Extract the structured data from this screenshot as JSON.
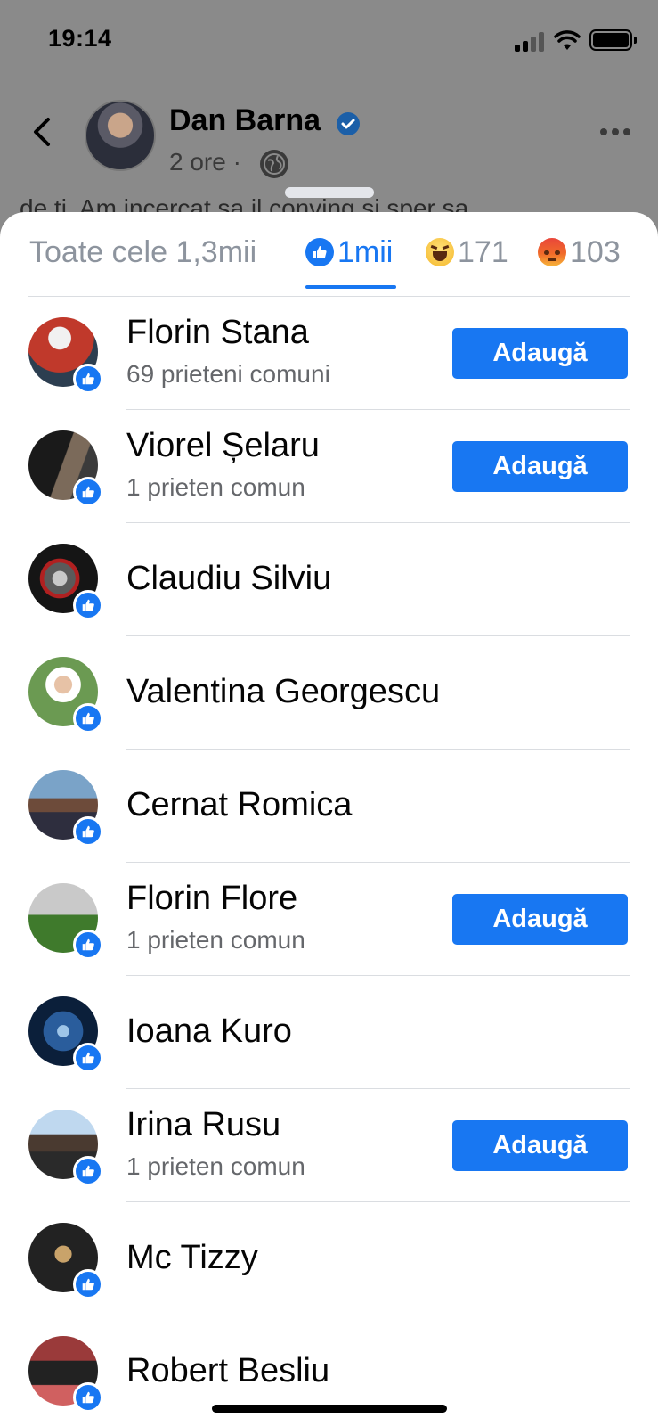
{
  "status_bar": {
    "time": "19:14"
  },
  "post_header": {
    "author": "Dan Barna",
    "time": "2 ore",
    "separator": "·",
    "text_peek": "de ti. Am incercat sa il conving si sper sa"
  },
  "tabs": [
    {
      "label": "Toate cele 1,3mii",
      "active": false
    },
    {
      "label": "1mii",
      "icon": "like-icon",
      "active": true
    },
    {
      "label": "171",
      "icon": "haha-emoji-icon",
      "active": false
    },
    {
      "label": "103",
      "icon": "angry-emoji-icon",
      "active": false
    }
  ],
  "people": [
    {
      "name": "Florin Stana",
      "mutual": "69 prieteni comuni",
      "button": "Adaugă"
    },
    {
      "name": "Viorel Șelaru",
      "mutual": "1 prieten comun",
      "button": "Adaugă"
    },
    {
      "name": "Claudiu Silviu"
    },
    {
      "name": "Valentina Georgescu"
    },
    {
      "name": "Cernat Romica"
    },
    {
      "name": "Florin Flore",
      "mutual": "1 prieten comun",
      "button": "Adaugă"
    },
    {
      "name": "Ioana Kuro"
    },
    {
      "name": "Irina Rusu",
      "mutual": "1 prieten comun",
      "button": "Adaugă"
    },
    {
      "name": "Mc Tizzy"
    },
    {
      "name": "Robert Besliu"
    }
  ],
  "colors": {
    "accent": "#1877f2",
    "secondary_text": "#65676b",
    "inactive_tab": "#8d949e"
  }
}
